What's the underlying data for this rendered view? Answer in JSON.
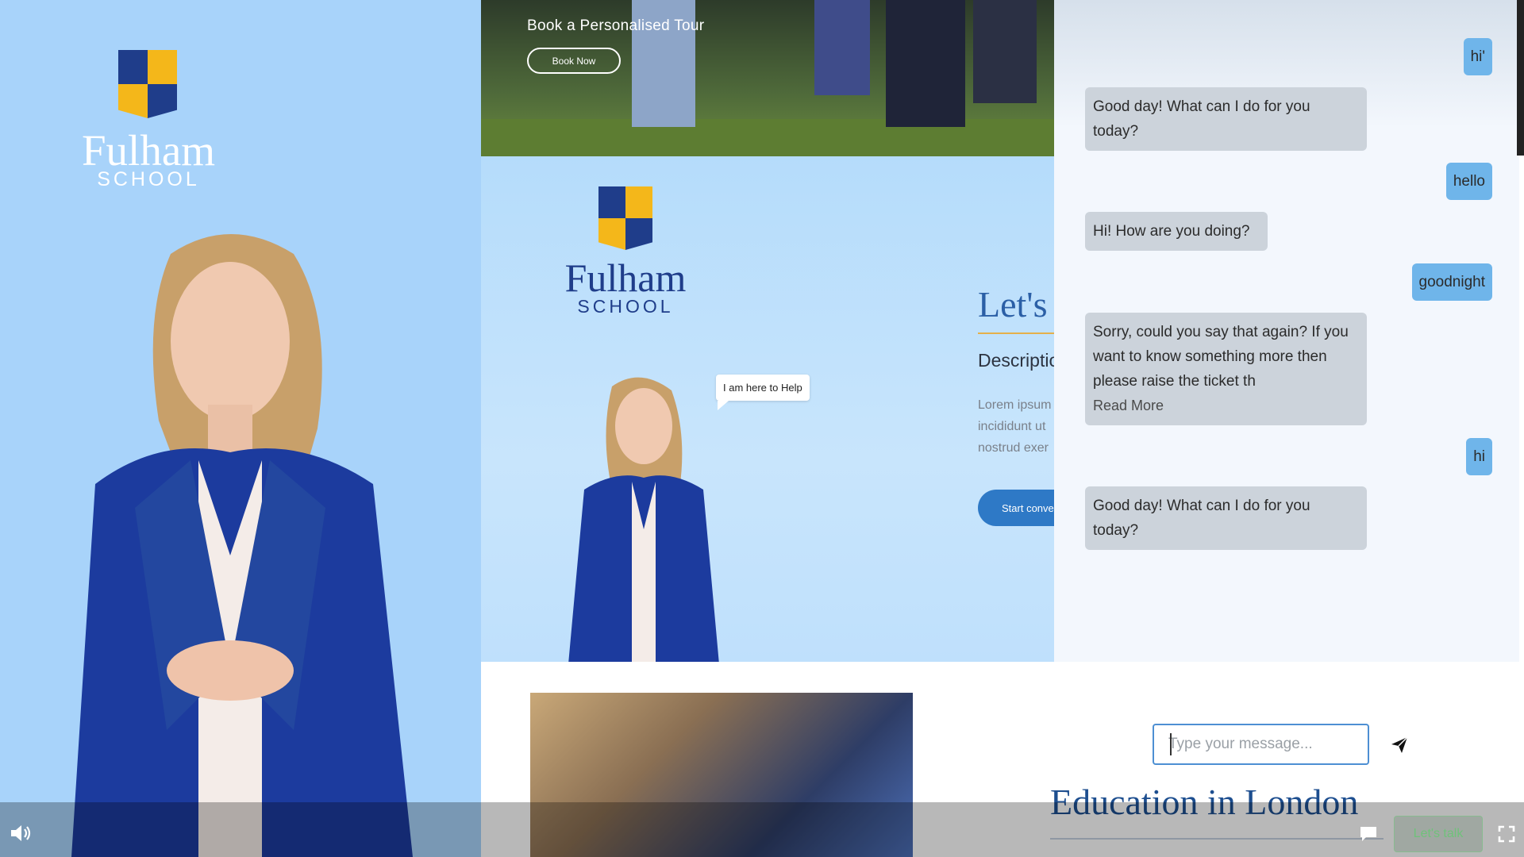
{
  "colors": {
    "brand_blue": "#1f3d8a",
    "brand_yellow": "#f4b71a",
    "user_bubble": "#6fb5ea",
    "bot_bubble": "#ccd3db",
    "link_blue": "#2e79c6"
  },
  "brand": {
    "name": "Fulham",
    "sub": "SCHOOL"
  },
  "site": {
    "tour_title": "Book a Personalised Tour",
    "book_now": "Book Now",
    "help_bubble": "I am here to Help",
    "lets_heading": "Let's",
    "desc_heading": "Descriptio",
    "lorem_lines": [
      "Lorem ipsum",
      "incididunt ut",
      "nostrud exer"
    ],
    "start_button": "Start conve",
    "edu_heading": "Education in London"
  },
  "chat": {
    "messages": [
      {
        "role": "user",
        "text": "hi'"
      },
      {
        "role": "bot",
        "text": "Good day! What can I do for you today?"
      },
      {
        "role": "user",
        "text": "hello"
      },
      {
        "role": "bot",
        "text": "Hi! How are you doing?"
      },
      {
        "role": "user",
        "text": "goodnight"
      },
      {
        "role": "bot",
        "text": "Sorry, could you say that again? If you want to know something more then please raise the ticket th",
        "read_more": "Read More"
      },
      {
        "role": "user",
        "text": "hi"
      },
      {
        "role": "bot",
        "text": "Good day! What can I do for you today?"
      }
    ],
    "input_placeholder": "Type your message...",
    "input_value": ""
  },
  "controls": {
    "lets_talk": "Let's talk",
    "icons": [
      "volume-icon",
      "chat-bubble-icon",
      "fullscreen-icon",
      "send-icon"
    ]
  }
}
